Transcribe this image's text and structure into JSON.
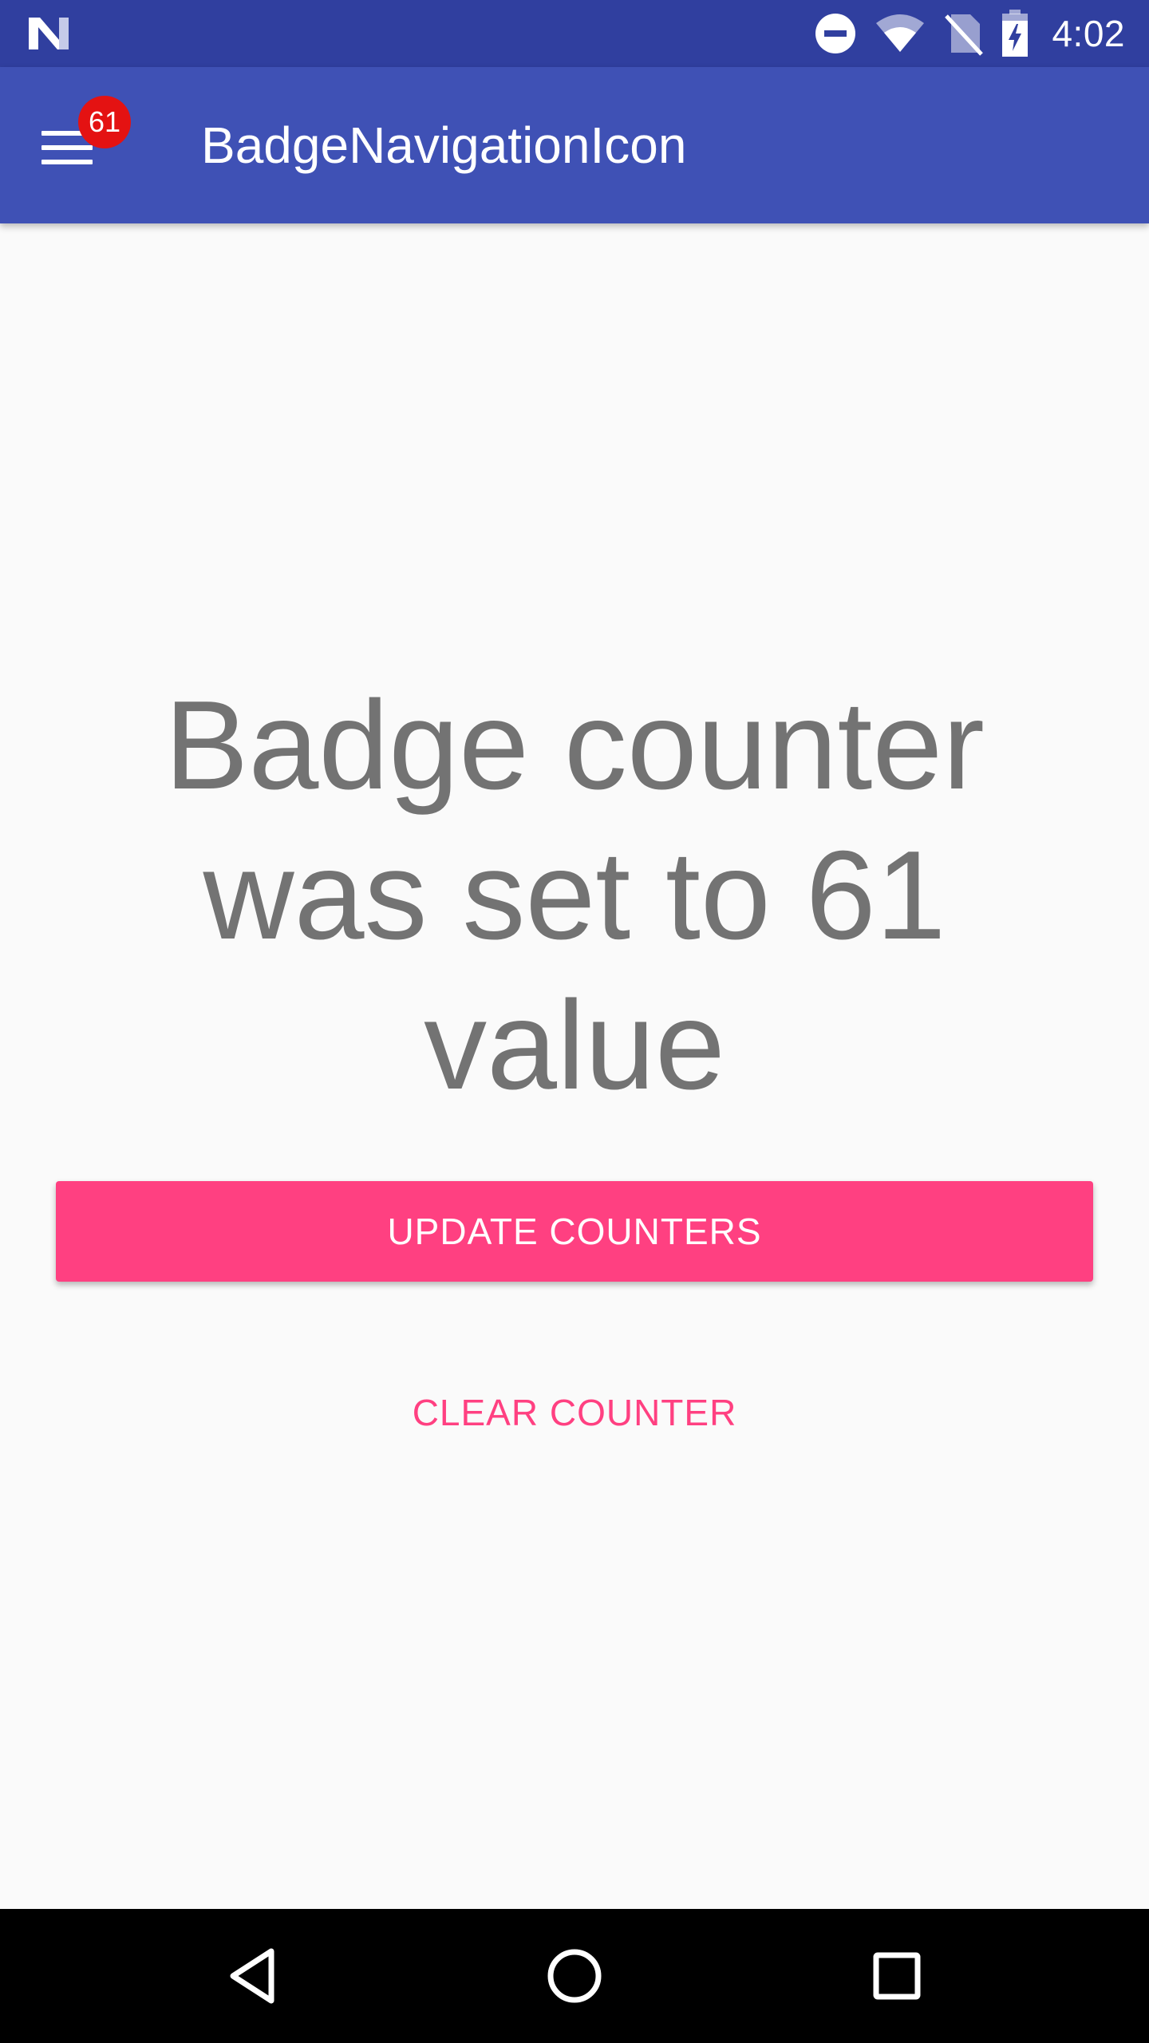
{
  "status_bar": {
    "time": "4:02",
    "icons": [
      "n-logo-icon",
      "do-not-disturb-icon",
      "wifi-icon",
      "no-sim-icon",
      "battery-charging-icon"
    ],
    "background_color": "#303F9F"
  },
  "toolbar": {
    "title": "BadgeNavigationIcon",
    "nav_icon": "hamburger-menu-icon",
    "badge_count": "61",
    "background_color": "#3F51B5",
    "badge_color": "#E41212"
  },
  "main": {
    "message": "Badge counter was set to 61 value",
    "update_button_label": "UPDATE COUNTERS",
    "clear_button_label": "CLEAR COUNTER",
    "accent_color": "#FF4081",
    "text_color": "#737373"
  },
  "nav_bar": {
    "buttons": [
      "back-icon",
      "home-icon",
      "recents-icon"
    ]
  }
}
